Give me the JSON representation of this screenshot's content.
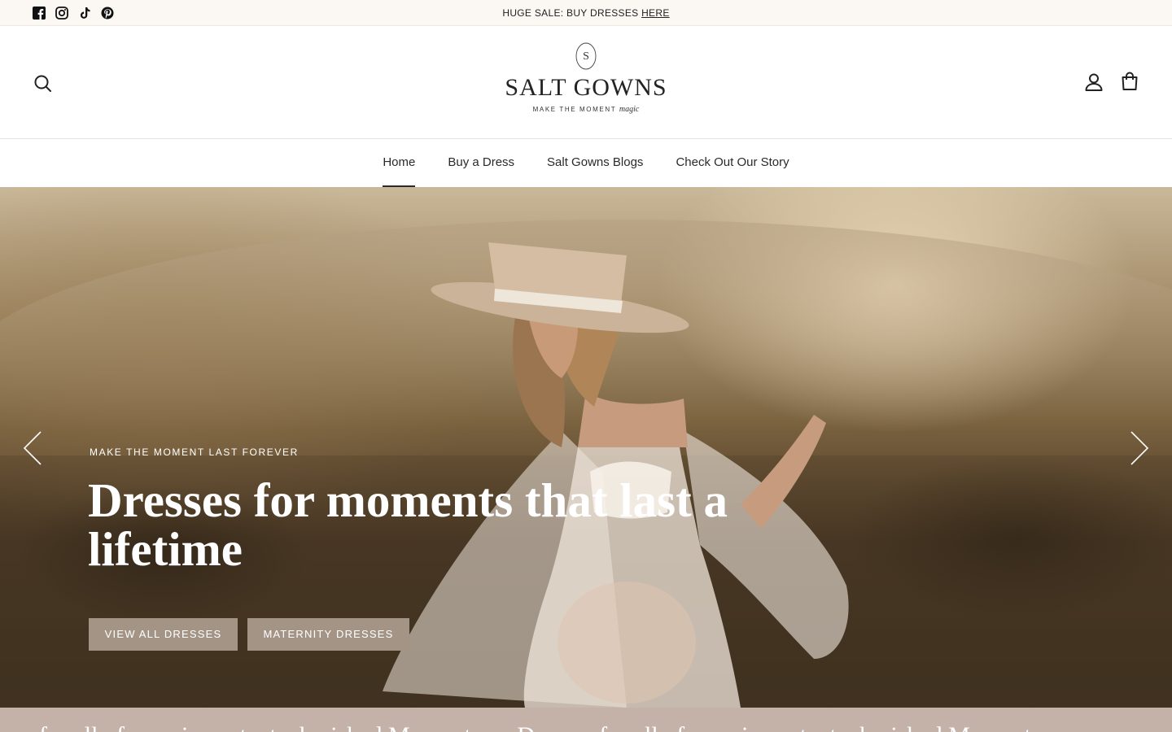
{
  "announcement": {
    "text": "HUGE SALE: BUY DRESSES ",
    "link": "HERE",
    "socials": [
      "facebook-icon",
      "instagram-icon",
      "tiktok-icon",
      "pinterest-icon"
    ]
  },
  "brand": {
    "name": "SALT GOWNS",
    "monogram": "S",
    "tagline": "MAKE THE MOMENT",
    "tagline_script": "magic"
  },
  "header_icons": [
    "search-icon",
    "account-icon",
    "cart-icon"
  ],
  "nav": {
    "items": [
      {
        "label": "Home",
        "active": true
      },
      {
        "label": "Buy a Dress",
        "active": false
      },
      {
        "label": "Salt Gowns Blogs",
        "active": false
      },
      {
        "label": "Check Out Our Story",
        "active": false
      }
    ]
  },
  "hero": {
    "eyebrow": "MAKE THE MOMENT LAST FOREVER",
    "headline": "Dresses for moments that last a lifetime",
    "buttons": [
      {
        "label": "VIEW ALL DRESSES"
      },
      {
        "label": "MATERNITY DRESSES"
      }
    ],
    "arrows": [
      "chevron-left-icon",
      "chevron-right-icon"
    ]
  },
  "marquee": {
    "text": "for all of your important, cherished Moments — Dresses for all of your important, cherished Moments"
  },
  "colors": {
    "announcement_bg": "#fbf7f3",
    "button_bg": "#a39486",
    "marquee_bg": "#c4b2a9",
    "text_dark": "#1f1f1f"
  }
}
